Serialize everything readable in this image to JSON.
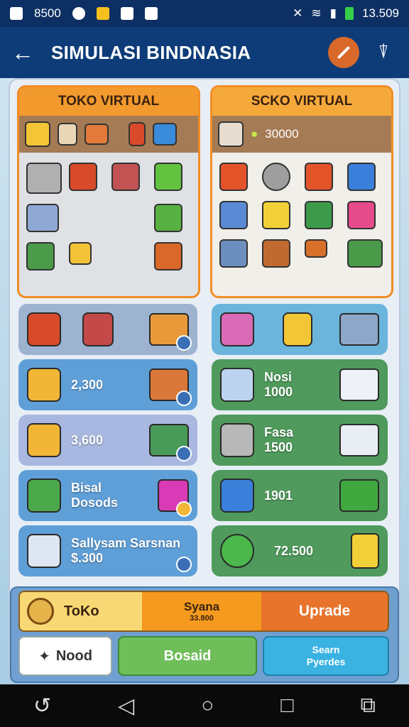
{
  "status": {
    "time_left": "8500",
    "time_right": "13.509"
  },
  "appbar": {
    "title": "SIMULASI BINDNASIA"
  },
  "shop_left": {
    "title": "TOKO VIRTUAL"
  },
  "shop_right": {
    "title": "SCKO VIRTUAL",
    "amount": "30000"
  },
  "tiles_left": [
    {
      "text": ""
    },
    {
      "text": "2,300"
    },
    {
      "text": "3,600"
    },
    {
      "line1": "Bisal",
      "line2": "Dosods"
    },
    {
      "line1": "Sallysam Sarsnan",
      "line2": "$.300"
    }
  ],
  "tiles_right": [
    {
      "text": ""
    },
    {
      "line1": "Nosi",
      "line2": "1000"
    },
    {
      "line1": "Fasa",
      "line2": "1500"
    },
    {
      "text": "1901"
    },
    {
      "text": "72.500"
    }
  ],
  "bar": {
    "toko": "ToKo",
    "center_top": "Syana",
    "center_bottom": "33.800",
    "upgrade": "Uprade"
  },
  "buttons": {
    "nood": "Nood",
    "bosaid": "Bosaid",
    "search_top": "Searn",
    "search_bottom": "Pyerdes"
  },
  "colors": {
    "accent_orange": "#f28d24",
    "header_blue": "#0e3c78",
    "tile_blue": "#5f9fd8",
    "tile_green": "#4f9a5c"
  }
}
